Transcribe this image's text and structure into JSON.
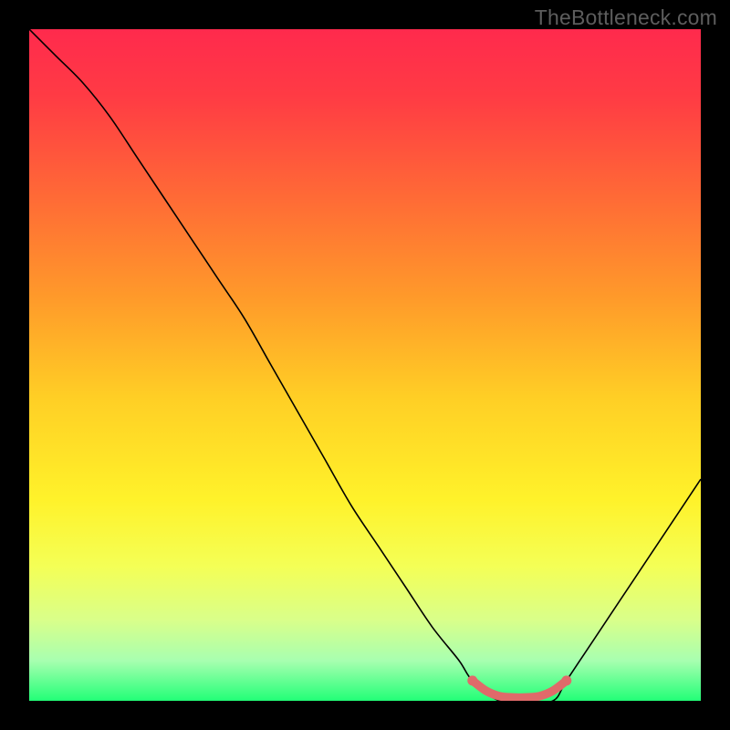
{
  "watermark": "TheBottleneck.com",
  "chart_data": {
    "type": "line",
    "title": "",
    "xlabel": "",
    "ylabel": "",
    "xlim": [
      0,
      100
    ],
    "ylim": [
      0,
      100
    ],
    "gradient_stops": [
      {
        "offset": 0.0,
        "color": "#ff2a4d"
      },
      {
        "offset": 0.1,
        "color": "#ff3b44"
      },
      {
        "offset": 0.25,
        "color": "#ff6a36"
      },
      {
        "offset": 0.4,
        "color": "#ff9a2a"
      },
      {
        "offset": 0.55,
        "color": "#ffcf25"
      },
      {
        "offset": 0.7,
        "color": "#fff22a"
      },
      {
        "offset": 0.8,
        "color": "#f4ff56"
      },
      {
        "offset": 0.88,
        "color": "#d9ff8a"
      },
      {
        "offset": 0.94,
        "color": "#a8ffb0"
      },
      {
        "offset": 1.0,
        "color": "#22ff77"
      }
    ],
    "series": [
      {
        "name": "bottleneck-curve",
        "color": "#000000",
        "width": 1.6,
        "x": [
          0,
          4,
          8,
          12,
          16,
          20,
          24,
          28,
          32,
          36,
          40,
          44,
          48,
          52,
          56,
          60,
          64,
          66,
          70,
          74,
          78,
          80,
          84,
          88,
          92,
          96,
          100
        ],
        "y": [
          100,
          96,
          92,
          87,
          81,
          75,
          69,
          63,
          57,
          50,
          43,
          36,
          29,
          23,
          17,
          11,
          6,
          3,
          0,
          0,
          0,
          3,
          9,
          15,
          21,
          27,
          33
        ]
      }
    ],
    "flat_segment": {
      "name": "optimal-range-highlight",
      "color": "#e06a6a",
      "radius": 5.5,
      "x": [
        66,
        68,
        70,
        72,
        74,
        76,
        78,
        80
      ],
      "y": [
        3,
        1.5,
        0.7,
        0.5,
        0.5,
        0.7,
        1.5,
        3
      ]
    }
  }
}
